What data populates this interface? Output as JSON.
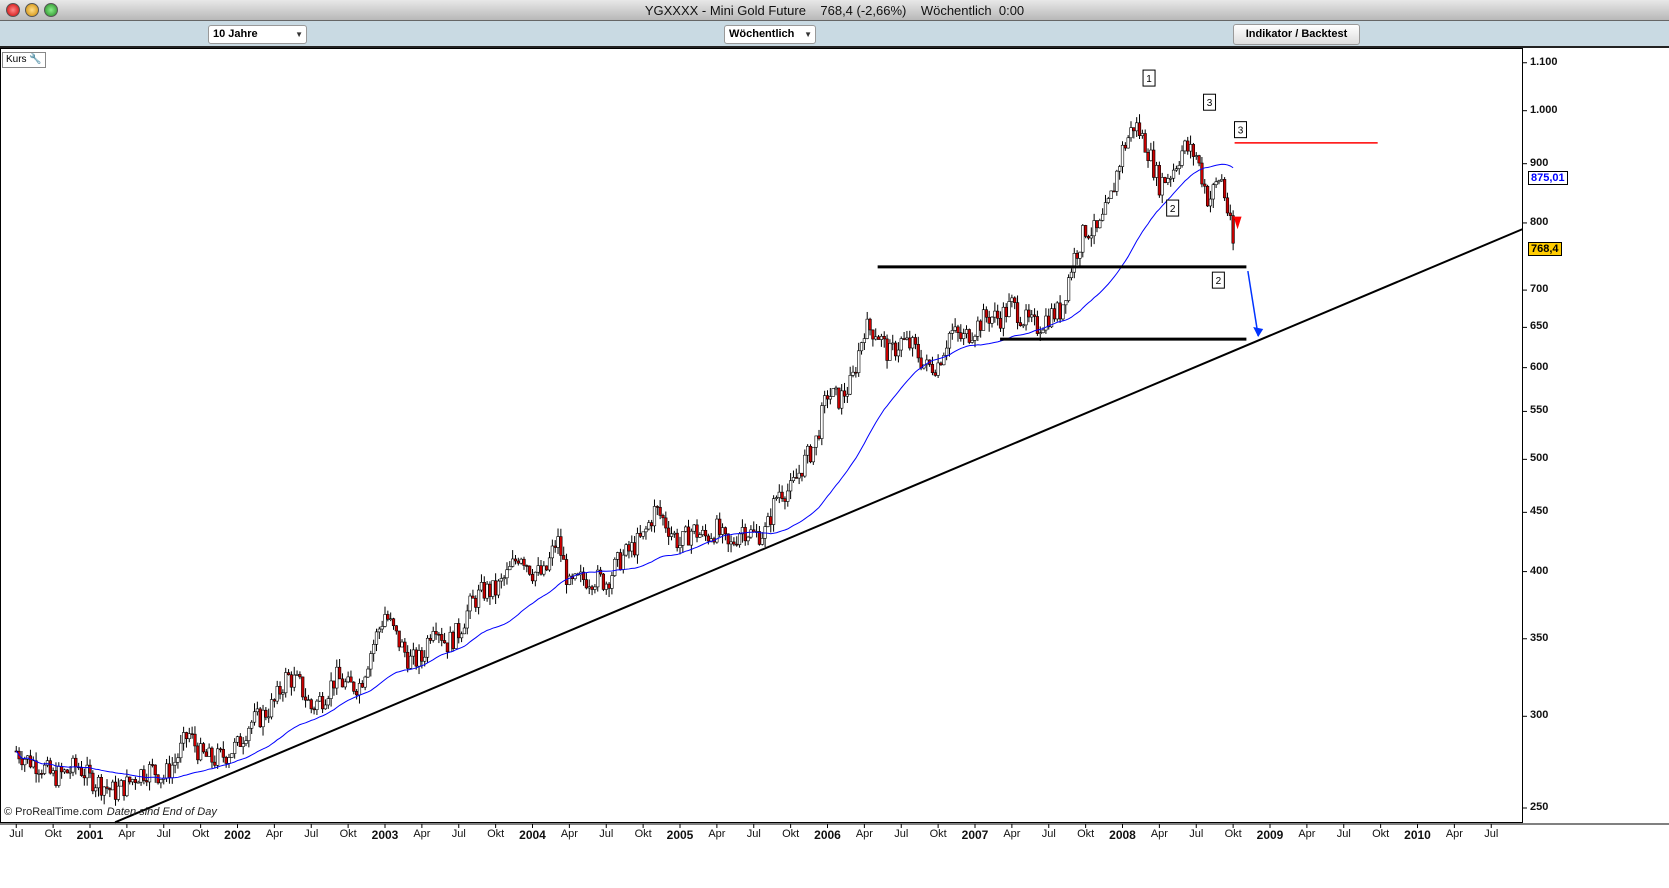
{
  "window": {
    "title": "YGXXXX - Mini Gold Future    768,4 (-2,66%)    Wöchentlich  0:00"
  },
  "toolbar": {
    "period": "10 Jahre",
    "interval": "Wöchentlich",
    "indicator_button": "Indikator / Backtest"
  },
  "chart_panel": {
    "label": "Kurs",
    "wrench_icon": "wrench-icon",
    "credit": "© ProRealTime.com",
    "credit_note": "Daten sind End of Day"
  },
  "colors": {
    "up": "#ffffff",
    "down": "#cc0000",
    "ma": "#0000ff",
    "trendline": "#000000",
    "resistance": "#ff0000",
    "arrow": "#0033ff",
    "last_price_bg": "#ffcc00"
  },
  "chart_data": {
    "type": "candlestick",
    "title": "YGXXXX - Mini Gold Future",
    "interval": "weekly",
    "y_scale": "log",
    "ylim": [
      245,
      1120
    ],
    "xlim": [
      "2000-06",
      "2010-10"
    ],
    "grid": false,
    "y_ticks": [
      "1.100",
      "1.000",
      "900",
      "800",
      "700",
      "650",
      "600",
      "550",
      "500",
      "450",
      "400",
      "350",
      "300",
      "250"
    ],
    "y_tick_values": [
      1100,
      1000,
      900,
      800,
      700,
      650,
      600,
      550,
      500,
      450,
      400,
      350,
      300,
      250
    ],
    "x_ticks": [
      "Jul",
      "Okt",
      "2001",
      "Apr",
      "Jul",
      "Okt",
      "2002",
      "Apr",
      "Jul",
      "Okt",
      "2003",
      "Apr",
      "Jul",
      "Okt",
      "2004",
      "Apr",
      "Jul",
      "Okt",
      "2005",
      "Apr",
      "Jul",
      "Okt",
      "2006",
      "Apr",
      "Jul",
      "Okt",
      "2007",
      "Apr",
      "Jul",
      "Okt",
      "2008",
      "Apr",
      "Jul",
      "Okt",
      "2009",
      "Apr",
      "Jul",
      "Okt",
      "2010",
      "Apr",
      "Jul"
    ],
    "monthly_close_start": "2000-07",
    "monthly_close": [
      280,
      275,
      272,
      266,
      268,
      272,
      265,
      262,
      258,
      262,
      268,
      270,
      266,
      275,
      290,
      278,
      275,
      278,
      283,
      296,
      300,
      308,
      325,
      320,
      305,
      312,
      324,
      318,
      320,
      345,
      368,
      350,
      335,
      336,
      364,
      346,
      355,
      375,
      385,
      385,
      398,
      416,
      400,
      397,
      427,
      388,
      394,
      395,
      392,
      408,
      418,
      428,
      453,
      438,
      422,
      435,
      428,
      435,
      418,
      437,
      430,
      433,
      470,
      470,
      495,
      515,
      570,
      563,
      583,
      650,
      645,
      615,
      632,
      625,
      600,
      605,
      645,
      635,
      650,
      665,
      662,
      680,
      660,
      650,
      665,
      672,
      745,
      790,
      785,
      835,
      925,
      975,
      930,
      865,
      885,
      930,
      915,
      835,
      880,
      768.4
    ],
    "moving_average": {
      "period_weeks": 40,
      "last_value": "875,01"
    },
    "last_price": "768,4",
    "change": "-2,66%",
    "annotations": [
      {
        "text": "1",
        "date": 2008.18,
        "price": 1067
      },
      {
        "text": "3",
        "date": 2008.59,
        "price": 1017
      },
      {
        "text": "2",
        "date": 2008.34,
        "price": 824
      },
      {
        "text": "3",
        "date": 2008.8,
        "price": 963
      },
      {
        "text": "2",
        "date": 2008.65,
        "price": 714
      }
    ],
    "lines": [
      {
        "kind": "support-top",
        "color": "#000000",
        "from": [
          2006.34,
          733
        ],
        "to": [
          2008.84,
          733
        ]
      },
      {
        "kind": "support-bottom",
        "color": "#000000",
        "from": [
          2007.17,
          635
        ],
        "to": [
          2008.84,
          635
        ]
      },
      {
        "kind": "resistance",
        "color": "#ff0000",
        "from": [
          2008.76,
          938
        ],
        "to": [
          2009.73,
          938
        ]
      },
      {
        "kind": "trendline",
        "color": "#000000",
        "from": [
          2001.17,
          243
        ],
        "to": [
          2010.71,
          790
        ]
      }
    ],
    "arrow": {
      "from": [
        2008.85,
        727
      ],
      "to": [
        2008.92,
        639
      ]
    }
  }
}
